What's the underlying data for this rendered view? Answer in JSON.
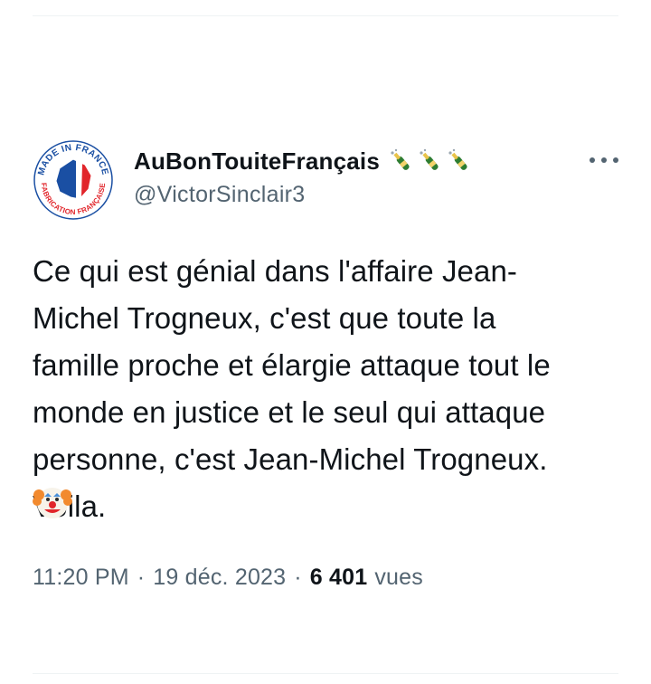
{
  "tweet": {
    "display_name": "AuBonTouiteFrançais",
    "name_badges": [
      "champagne-icon",
      "champagne-icon",
      "champagne-icon"
    ],
    "handle": "@VictorSinclair3",
    "avatar_icon": "made-in-france-logo",
    "avatar_text_top": "MADE IN FRANCE",
    "avatar_text_bottom": "FABRICATION FRANÇAISE",
    "text": "Ce qui est génial dans l'affaire Jean-\nMichel Trogneux, c'est que toute la\nfamille proche et élargie attaque tout le\nmonde en justice et le seul qui attaque\npersonne, c'est Jean-Michel Trogneux.\nVoila.",
    "emoji": "clown-face-icon",
    "time": "11:20 PM",
    "separator": "·",
    "date": "19 déc. 2023",
    "views_count": "6 401",
    "views_label": "vues"
  },
  "colors": {
    "text_primary": "#0f1419",
    "text_secondary": "#536471",
    "divider": "#eff3f4",
    "france_blue": "#1a4fa3",
    "france_red": "#e1252b"
  }
}
